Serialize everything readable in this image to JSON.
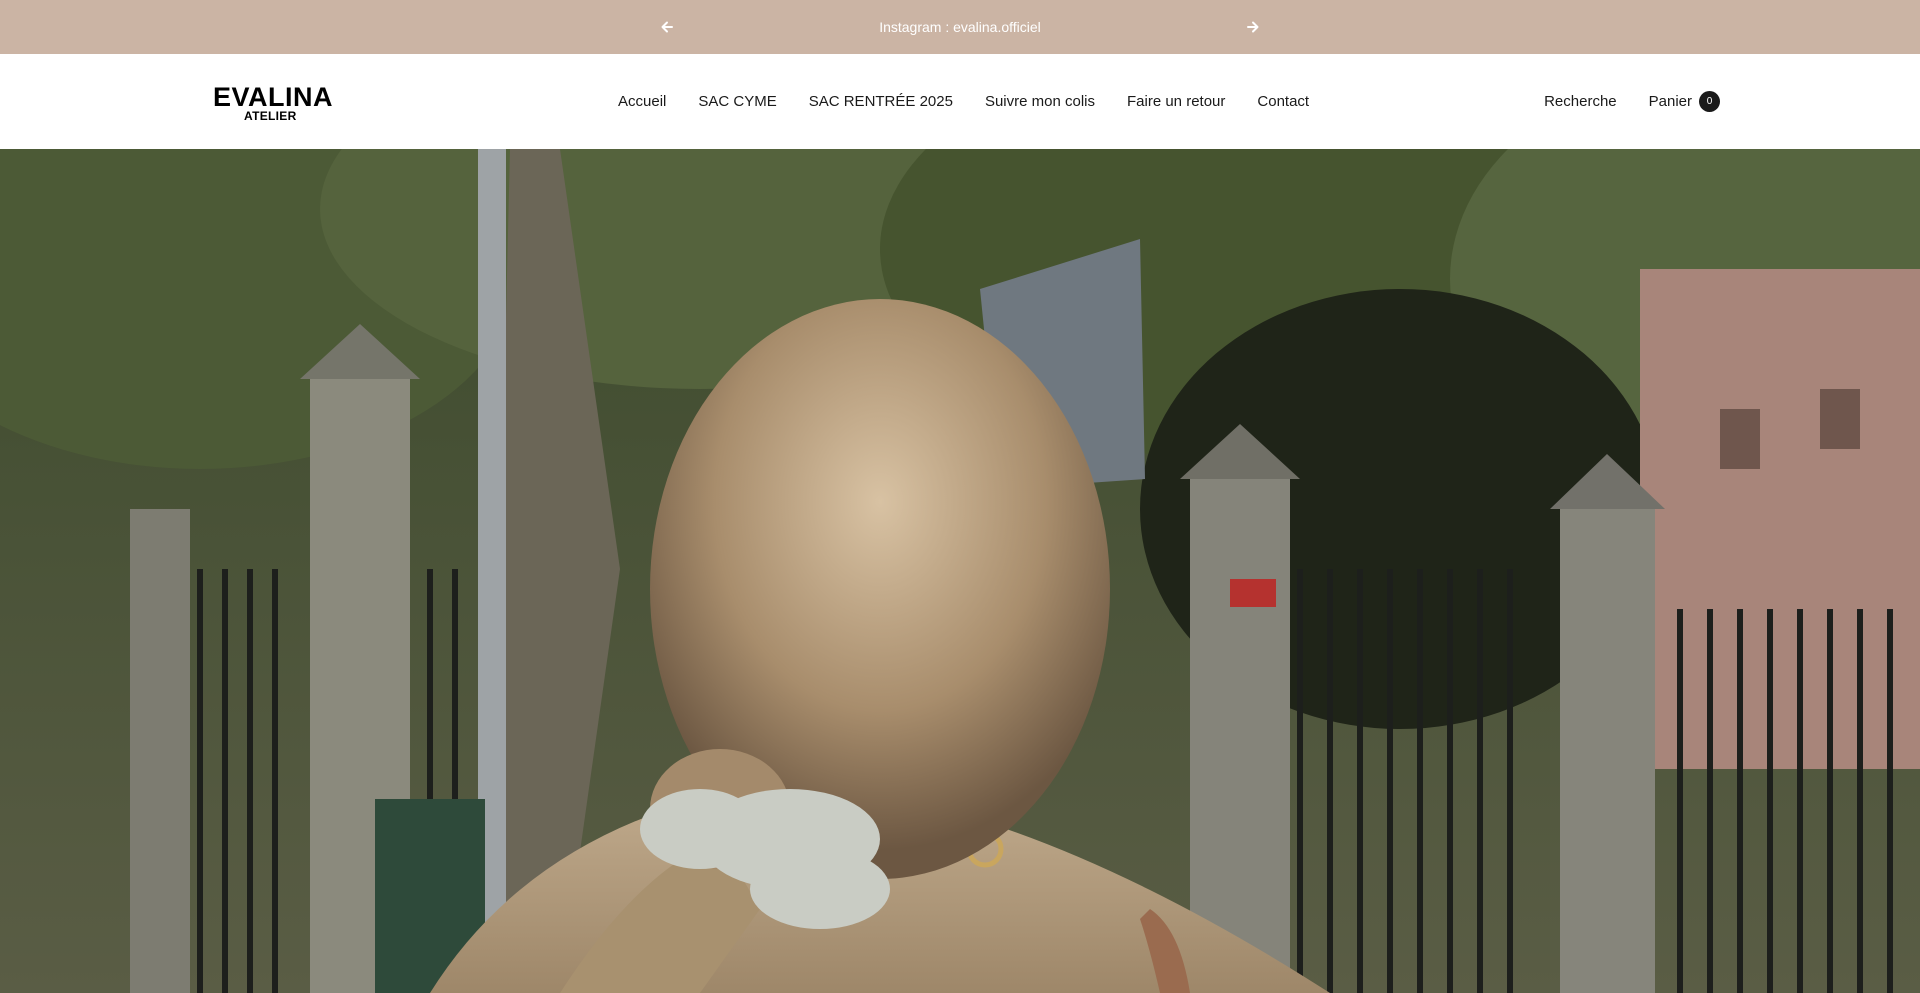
{
  "announcement": {
    "message": "Instagram : evalina.officiel",
    "prev_icon": "arrow-left-icon",
    "next_icon": "arrow-right-icon"
  },
  "header": {
    "logo_line1": "EVALINA",
    "logo_line2": "ATELIER",
    "nav": [
      {
        "label": "Accueil"
      },
      {
        "label": "SAC CYME"
      },
      {
        "label": "SAC RENTRÉE 2025"
      },
      {
        "label": "Suivre mon colis"
      },
      {
        "label": "Faire un retour"
      },
      {
        "label": "Contact"
      }
    ],
    "search_label": "Recherche",
    "cart_label": "Panier",
    "cart_count": "0"
  },
  "colors": {
    "announcement_bg": "#cbb4a4",
    "header_bg": "#ffffff",
    "text": "#1a1a1a",
    "badge_bg": "#1a1a1a"
  }
}
